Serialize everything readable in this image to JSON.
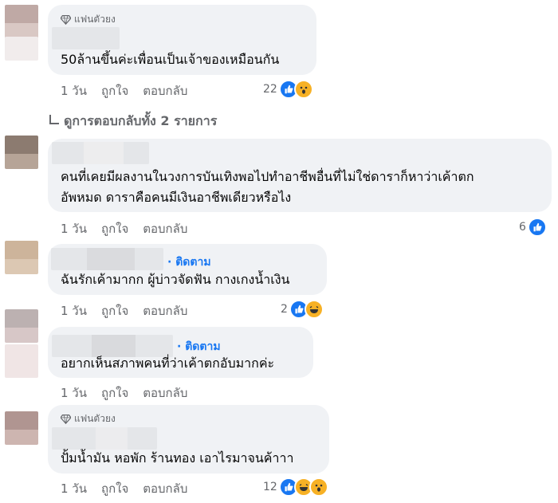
{
  "comments": [
    {
      "badge": "แฟนตัวยง",
      "text": "50ล้านขึ้นค่ะเพื่อนเป็นเจ้าของเหมือนกัน",
      "time": "1 วัน",
      "like_label": "ถูกใจ",
      "reply_label": "ตอบกลับ",
      "reaction_count": "22",
      "reactions": [
        "like-icon",
        "wow-icon"
      ]
    },
    {
      "text_line1": "คนที่เคยมีผลงานในวงการบันเทิงพอไปทำอาชีพอื่นที่ไม่ใช่ดาราก็หาว่าเค้าตก",
      "text_line2": "อัพหมด ดาราคือคนมีเงินอาชีพเดียวหรือไง",
      "time": "1 วัน",
      "like_label": "ถูกใจ",
      "reply_label": "ตอบกลับ",
      "reaction_count": "6",
      "reactions": [
        "like-icon"
      ]
    },
    {
      "follow": "· ติดตาม",
      "text": "ฉันรักเค้ามากก ผู้บ่าวจัดฟัน กางเกงน้ำเงิน",
      "time": "1 วัน",
      "like_label": "ถูกใจ",
      "reply_label": "ตอบกลับ",
      "reaction_count": "2",
      "reactions": [
        "like-icon",
        "haha-icon"
      ]
    },
    {
      "follow": "· ติดตาม",
      "text": "อยากเห็นสภาพคนที่ว่าเค้าตกอับมากค่ะ",
      "time": "1 วัน",
      "like_label": "ถูกใจ",
      "reply_label": "ตอบกลับ"
    },
    {
      "badge": "แฟนตัวยง",
      "text": "ปั้มน้ำมัน หอพัก ร้านทอง เอาไรมาจนค้าาา",
      "time": "1 วัน",
      "like_label": "ถูกใจ",
      "reply_label": "ตอบกลับ",
      "reaction_count": "12",
      "reactions": [
        "like-icon",
        "haha-icon",
        "wow-icon"
      ]
    }
  ],
  "view_replies": "ดูการตอบกลับทั้ง 2 รายการ",
  "colors": {
    "like": "#1877f2",
    "bubble": "#f0f2f5",
    "meta": "#65676b"
  }
}
